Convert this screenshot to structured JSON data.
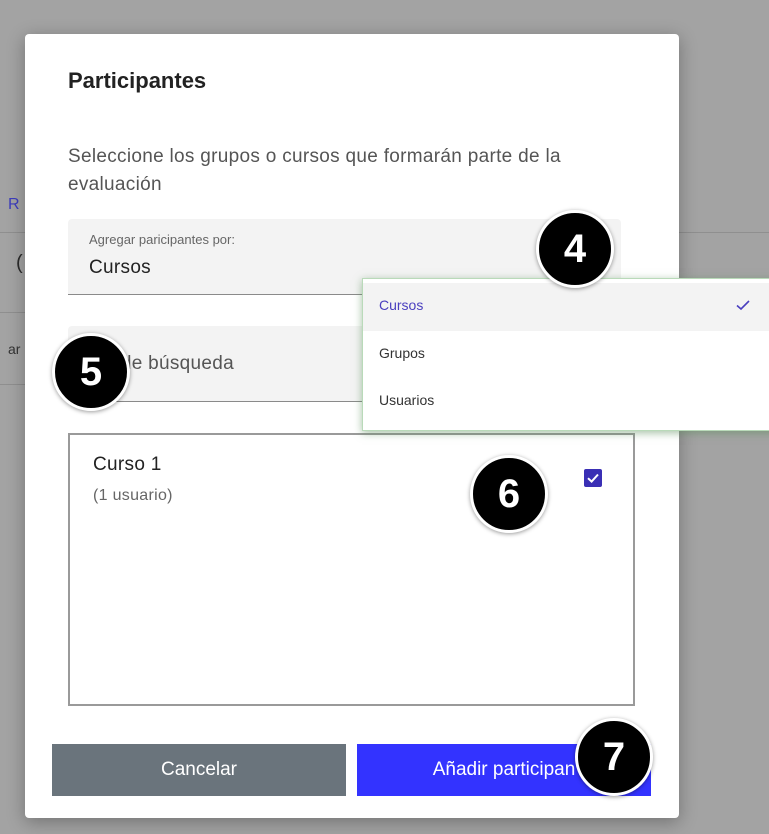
{
  "background": {
    "link_fragment": "R",
    "paren_fragment": "(",
    "text_fragment": "ar"
  },
  "modal": {
    "title": "Participantes",
    "description": "Seleccione los grupos o cursos que formarán parte de la evaluación",
    "select": {
      "label": "Agregar paricipantes por:",
      "value": "Cursos"
    },
    "search": {
      "placeholder": "ino de búsqueda"
    },
    "list": [
      {
        "name": "Curso 1",
        "count": "(1 usuario)",
        "checked": true
      }
    ],
    "buttons": {
      "cancel": "Cancelar",
      "add": "Añadir participan"
    }
  },
  "dropdown": {
    "options": [
      {
        "label": "Cursos",
        "selected": true
      },
      {
        "label": "Grupos",
        "selected": false
      },
      {
        "label": "Usuarios",
        "selected": false
      }
    ]
  },
  "badges": [
    "4",
    "5",
    "6",
    "7"
  ],
  "colors": {
    "accent": "#3333ff",
    "checkbox": "#3a2fb5",
    "cancel": "#6a747c",
    "selected_option": "#4a3fbf"
  }
}
